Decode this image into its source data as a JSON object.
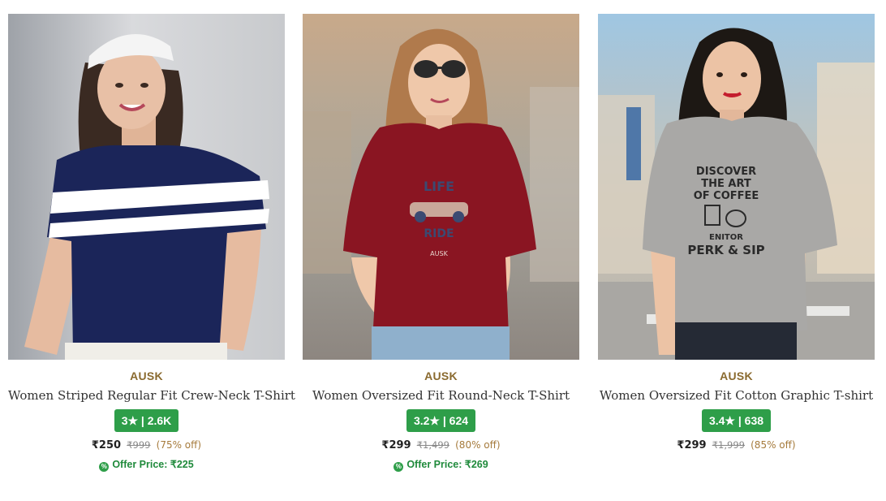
{
  "products": [
    {
      "brand": "AUSK",
      "name": "Women Striped Regular Fit Crew-Neck T-Shirt",
      "rating": "3★ | 2.6K",
      "price": "₹250",
      "mrp": "₹999",
      "discount": "(75% off)",
      "offer_price": "Offer Price: ₹225",
      "offer_icon": "%",
      "image": "woman-striped-navy-tshirt"
    },
    {
      "brand": "AUSK",
      "name": "Women Oversized Fit Round-Neck T-Shirt",
      "rating": "3.2★ | 624",
      "price": "₹299",
      "mrp": "₹1,499",
      "discount": "(80% off)",
      "offer_price": "Offer Price: ₹269",
      "offer_icon": "%",
      "image": "woman-maroon-graphic-tshirt",
      "print_text": [
        "LIFE",
        "RIDE",
        "AUSK"
      ]
    },
    {
      "brand": "AUSK",
      "name": "Women Oversized Fit Cotton Graphic T-shirt",
      "rating": "3.4★ | 638",
      "price": "₹299",
      "mrp": "₹1,999",
      "discount": "(85% off)",
      "image": "woman-grey-coffee-graphic-tshirt",
      "print_text": [
        "DISCOVER",
        "THE ART",
        "OF COFFEE",
        "ENITOR",
        "PERK & SIP"
      ]
    }
  ],
  "colors": {
    "rating_badge": "#2e9e49",
    "brand": "#8a6a2f",
    "offer": "#1f8a3b"
  }
}
